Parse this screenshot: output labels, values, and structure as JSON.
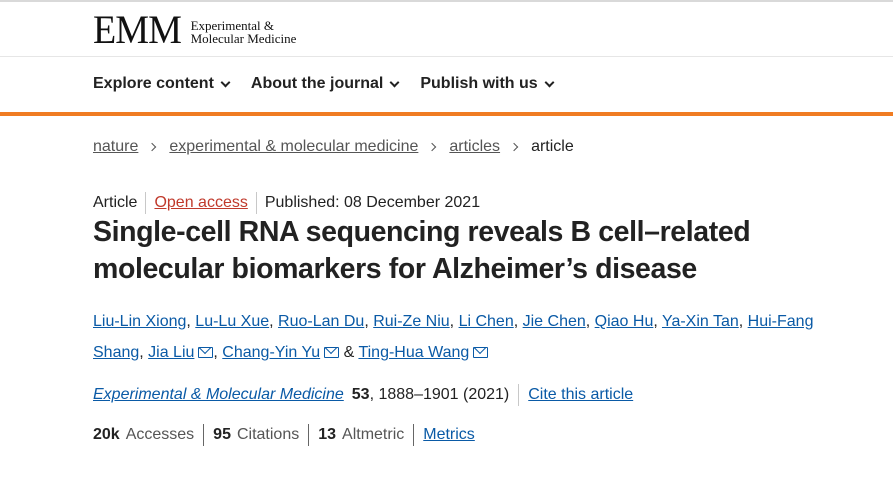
{
  "logo": {
    "mark": "EMM",
    "line1": "Experimental &",
    "line2": "Molecular Medicine"
  },
  "nav": {
    "items": [
      {
        "label": "Explore content"
      },
      {
        "label": "About the journal"
      },
      {
        "label": "Publish with us"
      }
    ]
  },
  "breadcrumb": {
    "items": [
      "nature",
      "experimental & molecular medicine",
      "articles"
    ],
    "current": "article"
  },
  "article": {
    "type": "Article",
    "access": "Open access",
    "published": "Published: 08 December 2021",
    "title": "Single-cell RNA sequencing reveals B cell–related molecular biomarkers for Alzheimer’s disease"
  },
  "authors": [
    "Liu-Lin Xiong",
    "Lu-Lu Xue",
    "Ruo-Lan Du",
    "Rui-Ze Niu",
    "Li Chen",
    "Jie Chen",
    "Qiao Hu",
    "Ya-Xin Tan",
    "Hui-Fang Shang",
    "Jia Liu",
    "Chang-Yin Yu",
    "Ting-Hua Wang"
  ],
  "citation": {
    "journal": "Experimental & Molecular Medicine",
    "volume": "53",
    "pages_year": ", 1888–1901 (2021)",
    "cite_label": "Cite this article"
  },
  "metrics": {
    "accesses_value": "20k",
    "accesses_label": "Accesses",
    "citations_value": "95",
    "citations_label": "Citations",
    "altmetric_value": "13",
    "altmetric_label": "Altmetric",
    "link_label": "Metrics"
  },
  "colors": {
    "accent_orange": "#f07c22",
    "link_blue": "#0a5aa6",
    "open_access_red": "#c0392b"
  }
}
